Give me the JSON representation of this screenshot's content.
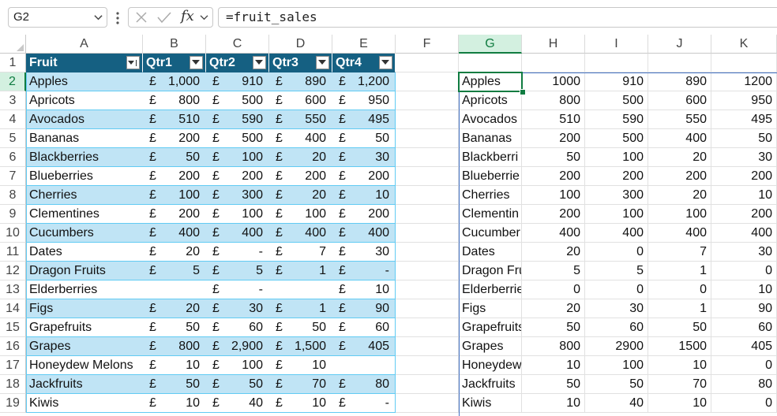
{
  "formula_bar": {
    "name_box": "G2",
    "formula": "=fruit_sales",
    "fx_label": "fx"
  },
  "columns": [
    "A",
    "B",
    "C",
    "D",
    "E",
    "F",
    "G",
    "H",
    "I",
    "J",
    "K"
  ],
  "selected_column": "G",
  "selected_row": "2",
  "rows": [
    "1",
    "2",
    "3",
    "4",
    "5",
    "6",
    "7",
    "8",
    "9",
    "10",
    "11",
    "12",
    "13",
    "14",
    "15",
    "16",
    "17",
    "18",
    "19"
  ],
  "table": {
    "headers": [
      "Fruit",
      "Qtr1",
      "Qtr2",
      "Qtr3",
      "Qtr4"
    ],
    "currency": "£",
    "rows": [
      {
        "fruit": "Apples",
        "q": [
          "1,000",
          "910",
          "890",
          "1,200"
        ],
        "c": [
          1,
          1,
          1,
          1
        ]
      },
      {
        "fruit": "Apricots",
        "q": [
          "800",
          "500",
          "600",
          "950"
        ],
        "c": [
          1,
          1,
          1,
          1
        ]
      },
      {
        "fruit": "Avocados",
        "q": [
          "510",
          "590",
          "550",
          "495"
        ],
        "c": [
          1,
          1,
          1,
          1
        ]
      },
      {
        "fruit": "Bananas",
        "q": [
          "200",
          "500",
          "400",
          "50"
        ],
        "c": [
          1,
          1,
          1,
          1
        ]
      },
      {
        "fruit": "Blackberries",
        "q": [
          "50",
          "100",
          "20",
          "30"
        ],
        "c": [
          1,
          1,
          1,
          1
        ]
      },
      {
        "fruit": "Blueberries",
        "q": [
          "200",
          "200",
          "200",
          "200"
        ],
        "c": [
          1,
          1,
          1,
          1
        ]
      },
      {
        "fruit": "Cherries",
        "q": [
          "100",
          "300",
          "20",
          "10"
        ],
        "c": [
          1,
          1,
          1,
          1
        ]
      },
      {
        "fruit": "Clementines",
        "q": [
          "200",
          "100",
          "100",
          "200"
        ],
        "c": [
          1,
          1,
          1,
          1
        ]
      },
      {
        "fruit": "Cucumbers",
        "q": [
          "400",
          "400",
          "400",
          "400"
        ],
        "c": [
          1,
          1,
          1,
          1
        ]
      },
      {
        "fruit": "Dates",
        "q": [
          "20",
          "-",
          "7",
          "30"
        ],
        "c": [
          1,
          1,
          1,
          1
        ]
      },
      {
        "fruit": "Dragon Fruits",
        "q": [
          "5",
          "5",
          "1",
          "-"
        ],
        "c": [
          1,
          1,
          1,
          1
        ]
      },
      {
        "fruit": "Elderberries",
        "q": [
          "",
          "-",
          "",
          "10"
        ],
        "c": [
          0,
          1,
          0,
          1
        ]
      },
      {
        "fruit": "Figs",
        "q": [
          "20",
          "30",
          "1",
          "90"
        ],
        "c": [
          1,
          1,
          1,
          1
        ]
      },
      {
        "fruit": "Grapefruits",
        "q": [
          "50",
          "60",
          "50",
          "60"
        ],
        "c": [
          1,
          1,
          1,
          1
        ]
      },
      {
        "fruit": "Grapes",
        "q": [
          "800",
          "2,900",
          "1,500",
          "405"
        ],
        "c": [
          1,
          1,
          1,
          1
        ]
      },
      {
        "fruit": "Honeydew Melons",
        "q": [
          "10",
          "100",
          "10",
          ""
        ],
        "c": [
          1,
          1,
          1,
          0
        ]
      },
      {
        "fruit": "Jackfruits",
        "q": [
          "50",
          "50",
          "70",
          "80"
        ],
        "c": [
          1,
          1,
          1,
          1
        ]
      },
      {
        "fruit": "Kiwis",
        "q": [
          "10",
          "40",
          "10",
          "-"
        ],
        "c": [
          1,
          1,
          1,
          1
        ]
      }
    ]
  },
  "spill": {
    "rows": [
      {
        "name": "Apples",
        "v": [
          "1000",
          "910",
          "890",
          "1200"
        ]
      },
      {
        "name": "Apricots",
        "v": [
          "800",
          "500",
          "600",
          "950"
        ]
      },
      {
        "name": "Avocados",
        "v": [
          "510",
          "590",
          "550",
          "495"
        ]
      },
      {
        "name": "Bananas",
        "v": [
          "200",
          "500",
          "400",
          "50"
        ]
      },
      {
        "name": "Blackberri",
        "v": [
          "50",
          "100",
          "20",
          "30"
        ]
      },
      {
        "name": "Blueberrie",
        "v": [
          "200",
          "200",
          "200",
          "200"
        ]
      },
      {
        "name": "Cherries",
        "v": [
          "100",
          "300",
          "20",
          "10"
        ]
      },
      {
        "name": "Clementin",
        "v": [
          "200",
          "100",
          "100",
          "200"
        ]
      },
      {
        "name": "Cucumber",
        "v": [
          "400",
          "400",
          "400",
          "400"
        ]
      },
      {
        "name": "Dates",
        "v": [
          "20",
          "0",
          "7",
          "30"
        ]
      },
      {
        "name": "Dragon Fru",
        "v": [
          "5",
          "5",
          "1",
          "0"
        ]
      },
      {
        "name": "Elderberrie",
        "v": [
          "0",
          "0",
          "0",
          "10"
        ]
      },
      {
        "name": "Figs",
        "v": [
          "20",
          "30",
          "1",
          "90"
        ]
      },
      {
        "name": "Grapefruits",
        "v": [
          "50",
          "60",
          "50",
          "60"
        ]
      },
      {
        "name": "Grapes",
        "v": [
          "800",
          "2900",
          "1500",
          "405"
        ]
      },
      {
        "name": "Honeydew",
        "v": [
          "10",
          "100",
          "10",
          "0"
        ]
      },
      {
        "name": "Jackfruits",
        "v": [
          "50",
          "50",
          "70",
          "80"
        ]
      },
      {
        "name": "Kiwis",
        "v": [
          "10",
          "40",
          "10",
          "0"
        ]
      }
    ]
  },
  "colors": {
    "table_header": "#156082",
    "band": "#c0e4f5",
    "band_border": "#61cbf3",
    "selection": "#107c41",
    "spill_border": "#4472c4"
  },
  "icons": [
    "chevron-down-icon",
    "more-vertical-icon",
    "cancel-icon",
    "enter-icon",
    "function-icon",
    "filter-dropdown-icon",
    "sort-filter-icon"
  ]
}
